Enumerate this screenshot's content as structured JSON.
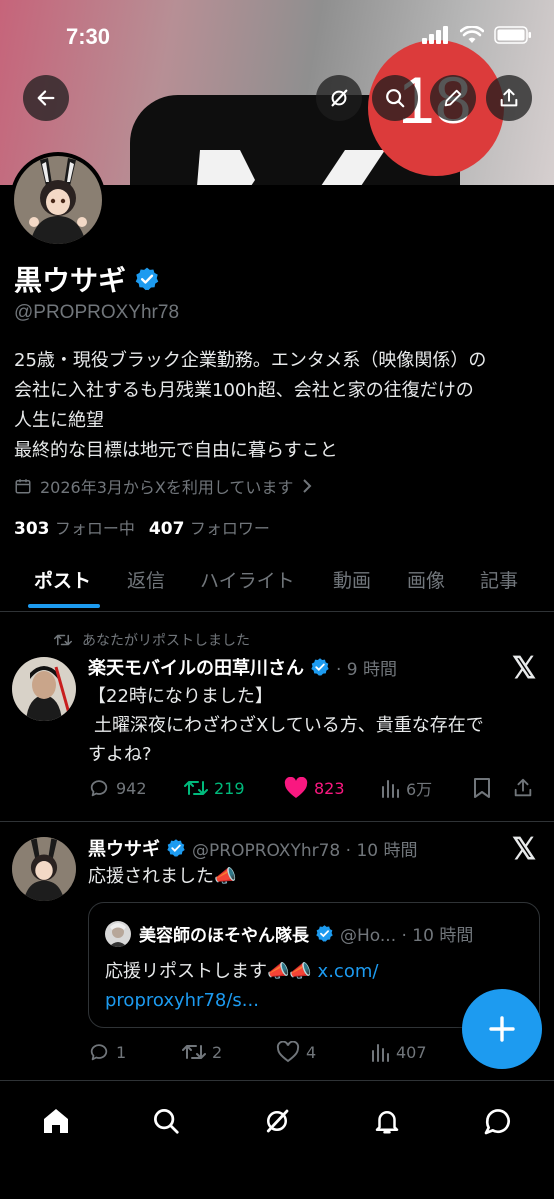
{
  "status_bar": {
    "time": "7:30"
  },
  "banner": {
    "badge_count": "18"
  },
  "profile": {
    "display_name": "黒ウサギ",
    "handle": "@PROPROXYhr78",
    "bio_lines": [
      "25歳・現役ブラック企業勤務。エンタメ系（映像関係）の",
      "会社に入社するも月残業100h超、会社と家の往復だけの",
      "人生に絶望",
      "最終的な目標は地元で自由に暮らすこと"
    ],
    "joined": "2026年3月からXを利用しています",
    "following_count": "303",
    "following_label": "フォロー中",
    "followers_count": "407",
    "followers_label": "フォロワー"
  },
  "tabs": [
    "ポスト",
    "返信",
    "ハイライト",
    "動画",
    "画像",
    "記事"
  ],
  "tweets": [
    {
      "repost_label": "あなたがリポストしました",
      "name": "楽天モバイルの田草川さん",
      "meta": "· 9 時間",
      "body_lines": [
        "【22時になりました】",
        "土曜深夜にわざわざXしている方、貴重な存在で",
        "すよね?"
      ],
      "replies": "942",
      "reposts": "219",
      "likes": "823",
      "views": "6万"
    },
    {
      "name": "黒ウサギ",
      "meta": "@PROPROXYhr78 · 10 時間",
      "body": "応援されました📣",
      "quote": {
        "name": "美容師のほそやん隊長",
        "meta": "@Ho... · 10 時間",
        "text": "応援リポストします📣📣 ",
        "link_part1": "x.com/",
        "link_part2": "proproxyhr78/s..."
      },
      "replies": "1",
      "reposts": "2",
      "likes": "4",
      "views": "407"
    }
  ],
  "x_logo_text": "𝕏",
  "colors": {
    "accent": "#1d9bf0",
    "like": "#f91880",
    "repost": "#00ba7c",
    "muted": "#71767b"
  }
}
